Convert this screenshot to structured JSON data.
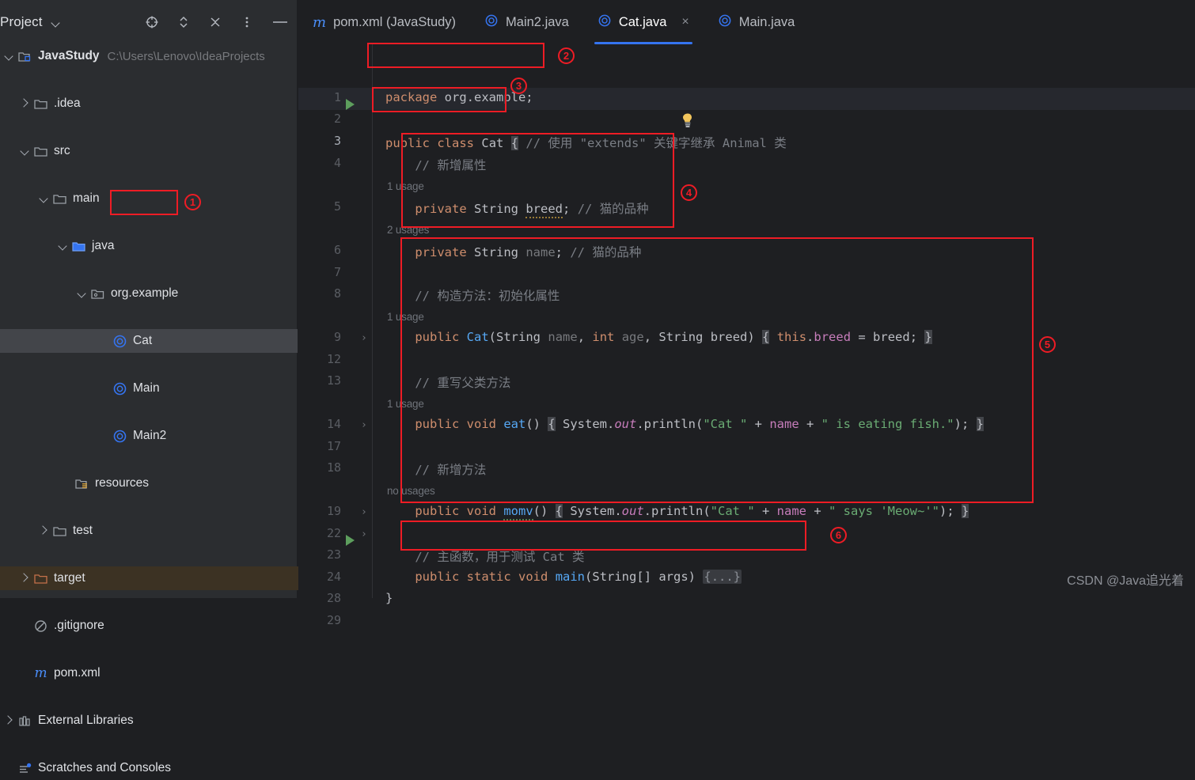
{
  "project_panel": {
    "title": "Project",
    "toolbar_icons": [
      "locate-icon",
      "expand-collapse-icon",
      "collapse-all-icon",
      "more-options-icon",
      "hide-icon"
    ],
    "tree": [
      {
        "label": "JavaStudy",
        "sub": "C:\\Users\\Lenovo\\IdeaProjects",
        "icon": "module-icon",
        "arrow": "down",
        "indent": 0
      },
      {
        "label": ".idea",
        "sub": "",
        "icon": "folder-icon",
        "arrow": "right",
        "indent": 1
      },
      {
        "label": "src",
        "sub": "",
        "icon": "folder-icon",
        "arrow": "down",
        "indent": 1
      },
      {
        "label": "main",
        "sub": "",
        "icon": "folder-icon",
        "arrow": "down",
        "indent": 2
      },
      {
        "label": "java",
        "sub": "",
        "icon": "source-folder-icon",
        "arrow": "down",
        "indent": 3
      },
      {
        "label": "org.example",
        "sub": "",
        "icon": "package-icon",
        "arrow": "down",
        "indent": 4
      },
      {
        "label": "Cat",
        "sub": "",
        "icon": "java-class-icon",
        "arrow": "none",
        "indent": 5
      },
      {
        "label": "Main",
        "sub": "",
        "icon": "java-class-icon",
        "arrow": "none",
        "indent": 5
      },
      {
        "label": "Main2",
        "sub": "",
        "icon": "java-class-icon",
        "arrow": "none",
        "indent": 5
      },
      {
        "label": "resources",
        "sub": "",
        "icon": "resources-folder-icon",
        "arrow": "none",
        "indent": 4
      },
      {
        "label": "test",
        "sub": "",
        "icon": "folder-icon",
        "arrow": "right",
        "indent": 2
      },
      {
        "label": "target",
        "sub": "",
        "icon": "target-folder-icon",
        "arrow": "right",
        "indent": 1
      },
      {
        "label": ".gitignore",
        "sub": "",
        "icon": "gitignore-icon",
        "arrow": "none",
        "indent": 1
      },
      {
        "label": "pom.xml",
        "sub": "",
        "icon": "maven-icon",
        "arrow": "none",
        "indent": 1
      },
      {
        "label": "External Libraries",
        "sub": "",
        "icon": "libraries-icon",
        "arrow": "right",
        "indent": 0
      },
      {
        "label": "Scratches and Consoles",
        "sub": "",
        "icon": "scratches-icon",
        "arrow": "none",
        "indent": 0
      }
    ]
  },
  "editor": {
    "tabs": [
      {
        "label": "pom.xml (JavaStudy)",
        "icon": "maven-icon",
        "active": false,
        "closable": false
      },
      {
        "label": "Main2.java",
        "icon": "java-class-icon",
        "active": false,
        "closable": false
      },
      {
        "label": "Cat.java",
        "icon": "java-class-icon",
        "active": true,
        "closable": true
      },
      {
        "label": "Main.java",
        "icon": "java-class-icon",
        "active": false,
        "closable": false
      }
    ],
    "close_glyph": "×",
    "line_numbers": [
      "1",
      "2",
      "3",
      "4",
      "5",
      "6",
      "7",
      "8",
      "9",
      "12",
      "13",
      "14",
      "17",
      "18",
      "19",
      "22",
      "23",
      "24",
      "28",
      "29"
    ],
    "current_line": "3",
    "code_lines": [
      {
        "n": "1",
        "text": "package org.example;"
      },
      {
        "n": "3",
        "text": "public class Cat { // 使用 \"extends\" 关键字继承 Animal 类"
      },
      {
        "n": "4",
        "text": "    // 新增属性"
      },
      {
        "n": "5",
        "text": "    private String breed; // 猫的品种"
      },
      {
        "n": "6",
        "text": "    private String name; // 猫的品种"
      },
      {
        "n": "8",
        "text": "    // 构造方法：初始化属性"
      },
      {
        "n": "9",
        "text": "    public Cat(String name, int age, String breed) { this.breed = breed; }"
      },
      {
        "n": "13",
        "text": "    // 重写父类方法"
      },
      {
        "n": "14",
        "text": "    public void eat() { System.out.println(\"Cat \" + name + \" is eating fish.\"); }"
      },
      {
        "n": "18",
        "text": "    // 新增方法"
      },
      {
        "n": "19",
        "text": "    public void momv() { System.out.println(\"Cat \" + name + \" says 'Meow~'\"); }"
      },
      {
        "n": "23",
        "text": "    // 主函数，用于测试 Cat 类"
      },
      {
        "n": "24",
        "text": "    public static void main(String[] args) {...}"
      },
      {
        "n": "28",
        "text": "}"
      }
    ],
    "usage_hints": [
      {
        "text": "1 usage",
        "for_line": "5"
      },
      {
        "text": "2 usages",
        "for_line": "6"
      },
      {
        "text": "1 usage",
        "for_line": "9"
      },
      {
        "text": "1 usage",
        "for_line": "14"
      },
      {
        "text": "no usages",
        "for_line": "19"
      }
    ]
  },
  "annotations": {
    "color": "#ee1c25",
    "markers": [
      {
        "id": "1",
        "target": "Cat class in project tree"
      },
      {
        "id": "2",
        "target": "package declaration"
      },
      {
        "id": "3",
        "target": "class declaration"
      },
      {
        "id": "4",
        "target": "fields block"
      },
      {
        "id": "5",
        "target": "methods block"
      },
      {
        "id": "6",
        "target": "main method"
      }
    ]
  },
  "watermark": "CSDN @Java追光着"
}
